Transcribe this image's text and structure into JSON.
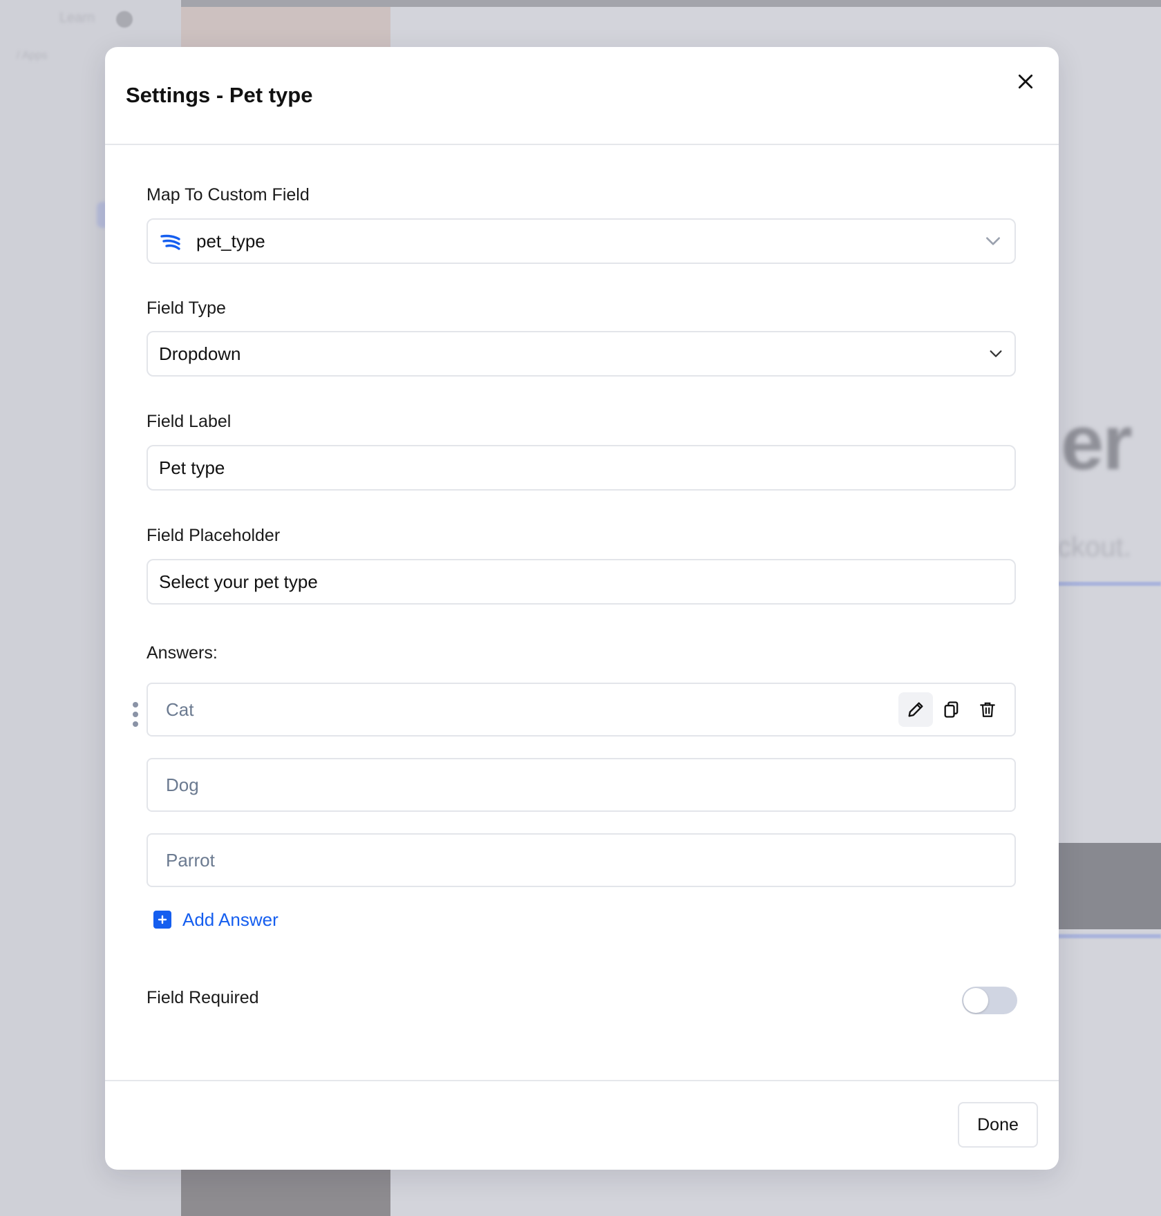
{
  "background": {
    "top_link": "Learn",
    "breadcrumb": "/ Apps",
    "headline_fragment": "er",
    "subtext_fragment": "ckout."
  },
  "modal": {
    "title": "Settings - Pet type"
  },
  "form": {
    "custom_field": {
      "label": "Map To Custom Field",
      "value": "pet_type"
    },
    "field_type": {
      "label": "Field Type",
      "value": "Dropdown"
    },
    "field_label": {
      "label": "Field Label",
      "value": "Pet type"
    },
    "field_placeholder": {
      "label": "Field Placeholder",
      "value": "Select your pet type"
    },
    "answers": {
      "heading": "Answers:",
      "items": [
        {
          "label": "Cat"
        },
        {
          "label": "Dog"
        },
        {
          "label": "Parrot"
        }
      ],
      "add_label": "Add Answer"
    },
    "required": {
      "label": "Field Required",
      "enabled": false
    }
  },
  "footer": {
    "done_label": "Done"
  },
  "colors": {
    "accent": "#155eef",
    "border": "#e3e5ea",
    "toggle_off": "#d0d5e2",
    "answer_text": "#6b7a90"
  },
  "icons": {
    "close": "close-icon",
    "brand": "custom-field-brand-icon",
    "chevron": "chevron-down-icon",
    "drag": "drag-handle-icon",
    "edit": "pencil-icon",
    "copy": "copy-icon",
    "delete": "trash-icon",
    "add": "plus-icon"
  }
}
